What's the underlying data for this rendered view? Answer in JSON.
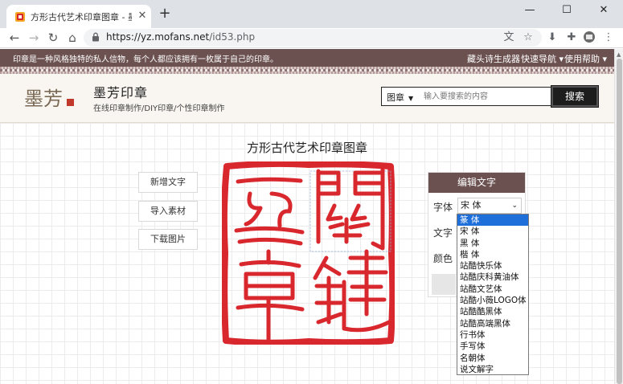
{
  "browser": {
    "tab_title": "方形古代艺术印章图章 - 墨芳印章",
    "new_tab": "+",
    "url_host": "https://yz.mofans.net",
    "url_path": "/id53.php",
    "win_minimize": "—",
    "win_maximize": "☐",
    "win_close": "✕",
    "tab_close": "✕"
  },
  "site": {
    "slogan": "印章是一种风格独特的私人信物，每个人都应该拥有一枚属于自己的印章。",
    "nav": [
      "藏头诗生成器",
      "快速导航 ▾",
      "使用帮助 ▾"
    ]
  },
  "header": {
    "logo_alt": "墨芳",
    "brand_name": "墨芳印章",
    "brand_sub": "在线印章制作/DIY印章/个性印章制作",
    "search_category": "图章",
    "search_placeholder": "输入要搜索的内容",
    "search_button": "搜索"
  },
  "main": {
    "title": "方形古代艺术印章图章",
    "buttons": [
      "新增文字",
      "导入素材",
      "下载图片"
    ],
    "seal_color": "#d9272e"
  },
  "panel": {
    "title": "编辑文字",
    "font_label": "字体",
    "text_label": "文字",
    "color_label": "颜色",
    "font_selected": "宋 体"
  },
  "font_options": [
    "篆 体",
    "宋 体",
    "黑 体",
    "楷 体",
    "站酷快乐体",
    "站酷庆科黄油体",
    "站酷文艺体",
    "站酷小薇LOGO体",
    "站酷酷黑体",
    "站酷高端黑体",
    "行书体",
    "手写体",
    "名朝体",
    "说文解字"
  ],
  "colors": {
    "brand_brown": "#6b5150",
    "select_blue": "#1e6fd9",
    "seal_red": "#d9272e"
  }
}
